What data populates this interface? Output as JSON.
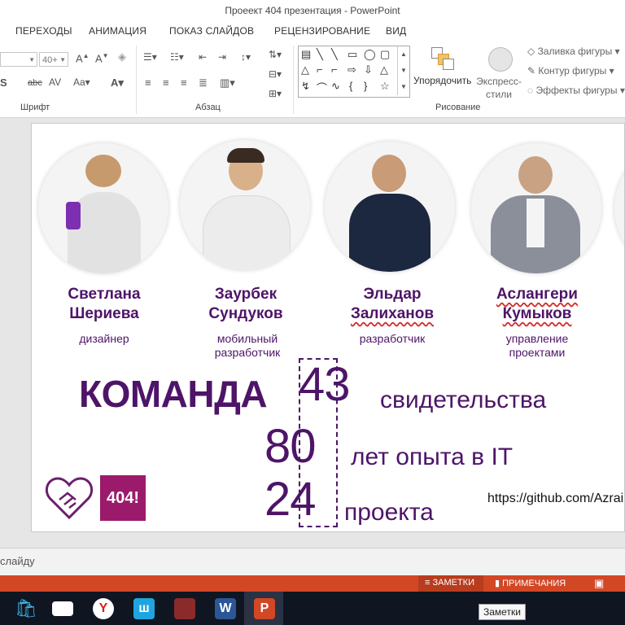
{
  "window": {
    "title": "Проеект 404  презентация - PowerPoint"
  },
  "tabs": [
    "ПЕРЕХОДЫ",
    "АНИМАЦИЯ",
    "ПОКАЗ СЛАЙДОВ",
    "РЕЦЕНЗИРОВАНИЕ",
    "ВИД"
  ],
  "ribbon": {
    "font_size_value": "40+",
    "groups": {
      "font": "Шрифт",
      "paragraph": "Абзац",
      "drawing": "Рисование"
    },
    "arrange_label": "Упорядочить",
    "quick_styles_label": "Экспресс-стили",
    "shape_fill": "Заливка фигуры",
    "shape_outline": "Контур фигуры",
    "shape_effects": "Эффекты фигуры"
  },
  "slide": {
    "team": [
      {
        "first": "Светлана",
        "last": "Шериева",
        "role": "дизайнер"
      },
      {
        "first": "Заурбек",
        "last": "Сундуков",
        "role": "мобильный разработчик"
      },
      {
        "first": "Эльдар",
        "last": "Залиханов",
        "role": "разработчик"
      },
      {
        "first": "Аслангери",
        "last": "Кумыков",
        "role": "управление проектами"
      }
    ],
    "headline": "КОМАНДА",
    "stats": [
      {
        "number": "43",
        "label": "свидетельства"
      },
      {
        "number": "80",
        "label": "лет опыта в IT"
      },
      {
        "number": "24",
        "label": "проекта"
      }
    ],
    "logo_text": "404!",
    "github_url": "https://github.com/Azrai"
  },
  "notes_placeholder": "слайду",
  "statusbar": {
    "notes_button": "ЗАМЕТКИ",
    "comments_button": "ПРИМЕЧАНИЯ"
  },
  "tooltip": "Заметки",
  "colors": {
    "accent": "#4e1468",
    "status": "#d24726",
    "logo_bg": "#9b1a6b"
  }
}
